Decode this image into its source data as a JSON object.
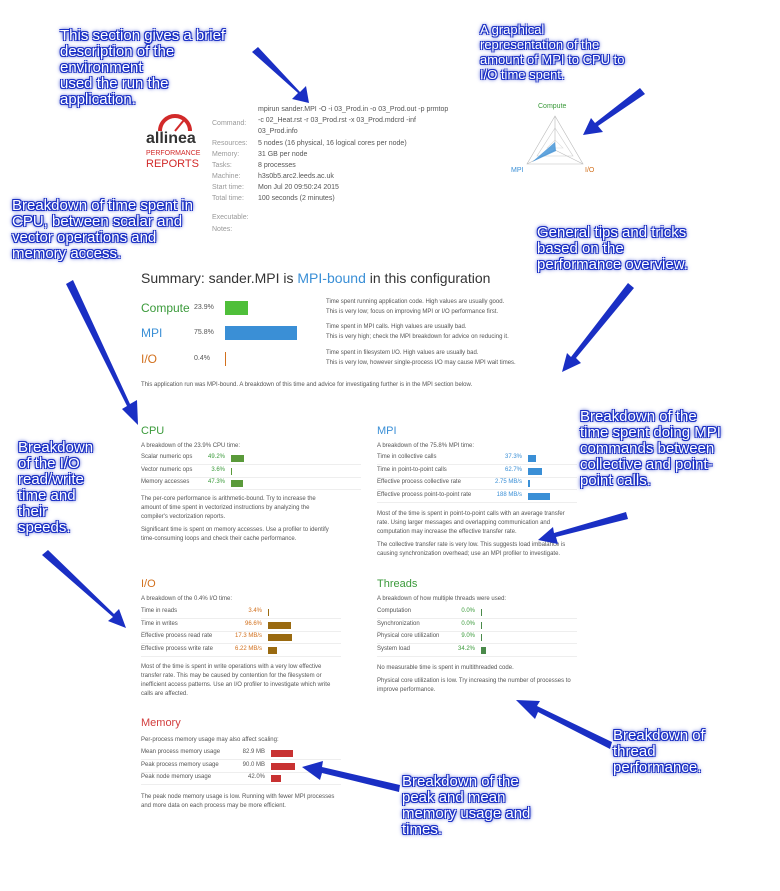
{
  "callouts": {
    "environment": "This section gives a brief\ndescription of the\nenvironment\nused the run the\napplication.",
    "graphical": "A graphical\nrepresentation of the\namount of MPI to CPU to\nI/O time spent.",
    "cpu_breakdown": "Breakdown of time spent in\nCPU, between scalar and\nvector operations and\nmemory access.",
    "tips": "General tips and tricks\nbased on the\nperformance overview.",
    "mpi_breakdown": "Breakdown of the\ntime spent doing MPI\ncommands between\ncollective and point-\npoint calls.",
    "io_breakdown": "Breakdown\nof the I/O\nread/write\ntime and\ntheir\nspeeds.",
    "thread_breakdown": "Breakdown of\nthread\nperformance.",
    "memory_breakdown": "Breakdown of the\npeak and mean\nmemory usage and\ntimes."
  },
  "logo": {
    "brand": "allinea",
    "line1": "PERFORMANCE",
    "line2": "REPORTS"
  },
  "env": {
    "command_label": "Command:",
    "command_value": "mpirun sander.MPI -O -i 03_Prod.in -o 03_Prod.out -p prmtop\n-c 02_Heat.rst -r 03_Prod.rst -x 03_Prod.mdcrd -inf\n03_Prod.info",
    "resources_label": "Resources:",
    "resources_value": "5 nodes (16 physical, 16 logical cores per node)",
    "memory_label": "Memory:",
    "memory_value": "31 GB per node",
    "tasks_label": "Tasks:",
    "tasks_value": "8 processes",
    "machine_label": "Machine:",
    "machine_value": "h3s0b5.arc2.leeds.ac.uk",
    "start_label": "Start time:",
    "start_value": "Mon Jul 20 09:50:24 2015",
    "total_label": "Total time:",
    "total_value": "100 seconds (2 minutes)",
    "executable_label": "Executable:",
    "notes_label": "Notes:"
  },
  "radar": {
    "compute": "Compute",
    "mpi": "MPI",
    "io": "I/O"
  },
  "summary": {
    "prefix": "Summary: sander.MPI is ",
    "highlight": "MPI-bound",
    "suffix": " in this configuration",
    "compute_label": "Compute",
    "compute_pct": "23.9%",
    "compute_value": 23.9,
    "mpi_label": "MPI",
    "mpi_pct": "75.8%",
    "mpi_value": 75.8,
    "io_label": "I/O",
    "io_pct": "0.4%",
    "io_value": 0.4,
    "compute_text1": "Time spent running application code. High values are usually good.",
    "compute_text2": "This is very low; focus on improving MPI or I/O performance first.",
    "mpi_text1": "Time spent in MPI calls. High values are usually bad.",
    "mpi_text2": "This is very high; check the MPI breakdown for advice on reducing it.",
    "io_text1": "Time spent in filesystem I/O. High values are usually bad.",
    "io_text2": "This is very low, however single-process I/O may cause MPI wait times.",
    "conclusion": "This application run was MPI-bound. A breakdown of this time and advice for investigating further is in the MPI section below."
  },
  "cpu": {
    "title": "CPU",
    "intro": "A breakdown of the 23.9% CPU time:",
    "rows": [
      {
        "label": "Scalar numeric ops",
        "value": "49.2%",
        "frac": 0.492
      },
      {
        "label": "Vector numeric ops",
        "value": "3.6%",
        "frac": 0.036
      },
      {
        "label": "Memory accesses",
        "value": "47.3%",
        "frac": 0.473
      }
    ],
    "text1": "The per-core performance is arithmetic-bound. Try to increase the\namount of time spent in vectorized instructions by analyzing the\ncompiler's vectorization reports.",
    "text2": "Significant time is spent on memory accesses. Use a profiler to identify\ntime-consuming loops and check their cache performance."
  },
  "mpi": {
    "title": "MPI",
    "intro": "A breakdown of the 75.8% MPI time:",
    "rows": [
      {
        "label": "Time in collective calls",
        "value": "37.3%",
        "frac": 0.373
      },
      {
        "label": "Time in point-to-point calls",
        "value": "62.7%",
        "frac": 0.627
      },
      {
        "label": "Effective process collective rate",
        "value": "2.75 MB/s",
        "frac": 0.1
      },
      {
        "label": "Effective process point-to-point rate",
        "value": "188 MB/s",
        "frac": 1.0
      }
    ],
    "text1": "Most of the time is spent in point-to-point calls with an average transfer\nrate. Using larger messages and overlapping communication and\ncomputation may increase the effective transfer rate.",
    "text2": "The collective transfer rate is very low. This suggests load imbalance is\ncausing synchronization overhead; use an MPI profiler to investigate."
  },
  "io": {
    "title": "I/O",
    "intro": "A breakdown of the 0.4% I/O time:",
    "rows": [
      {
        "label": "Time in reads",
        "value": "3.4%",
        "frac": 0.034
      },
      {
        "label": "Time in writes",
        "value": "96.6%",
        "frac": 0.966
      },
      {
        "label": "Effective process read rate",
        "value": "17.3 MB/s",
        "frac": 1.0
      },
      {
        "label": "Effective process write rate",
        "value": "6.22 MB/s",
        "frac": 0.36
      }
    ],
    "text1": "Most of the time is spent in write operations with a very low effective\ntransfer rate. This may be caused by contention for the filesystem or\ninefficient access patterns. Use an I/O profiler to investigate which write\ncalls are affected."
  },
  "threads": {
    "title": "Threads",
    "intro": "A breakdown of how multiple threads were used:",
    "rows": [
      {
        "label": "Computation",
        "value": "0.0%",
        "frac": 0.0
      },
      {
        "label": "Synchronization",
        "value": "0.0%",
        "frac": 0.0
      },
      {
        "label": "Physical core utilization",
        "value": "9.0%",
        "frac": 0.09
      },
      {
        "label": "System load",
        "value": "34.2%",
        "frac": 0.342
      }
    ],
    "text1": "No measurable time is spent in multithreaded code.",
    "text2": "Physical core utilization is low. Try increasing the number of processes to\nimprove performance."
  },
  "memory": {
    "title": "Memory",
    "intro": "Per-process memory usage may also affect scaling:",
    "rows": [
      {
        "label": "Mean process memory usage",
        "value": "82.9 MB",
        "frac": 0.92
      },
      {
        "label": "Peak process memory usage",
        "value": "90.0 MB",
        "frac": 1.0
      },
      {
        "label": "Peak node memory usage",
        "value": "42.0%",
        "frac": 0.42
      }
    ],
    "text1": "The peak node memory usage is low. Running with fewer MPI processes\nand more data on each process may be more efficient."
  },
  "colors": {
    "compute": "#4fbf3a",
    "mpi": "#3a8fd6",
    "io": "#d2701d",
    "memory": "#c83232",
    "cpu_bar": "#5a9a3a",
    "mpi_bar": "#3a8fd6",
    "io_bar": "#9a6a10",
    "threads_bar": "#4a8a4a",
    "arrow": "#1a2fc4"
  }
}
